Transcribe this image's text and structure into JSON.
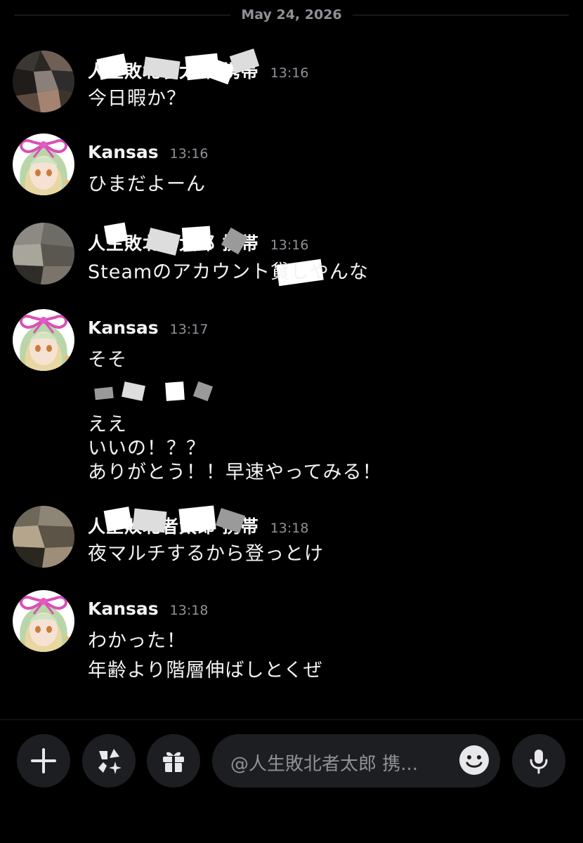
{
  "date_divider": "May 24, 2026",
  "messages": [
    {
      "author": "人生敗北者太郎 携帯",
      "time": "13:16",
      "lines": [
        "今日暇か？"
      ]
    },
    {
      "author": "Kansas",
      "time": "13:16",
      "lines": [
        "ひまだよーん"
      ]
    },
    {
      "author": "人生敗北者太郎 携帯",
      "time": "13:16",
      "lines": [
        "Steamのアカウント貸しやんな"
      ]
    },
    {
      "author": "Kansas",
      "time": "13:17",
      "lines": [
        "そそ"
      ]
    },
    {
      "author": "",
      "time": "",
      "lines": [
        "ええ",
        "いいの！？？",
        "ありがとう！！早速やってみる！"
      ]
    },
    {
      "author": "人生敗北者太郎 携帯",
      "time": "13:18",
      "lines": [
        "夜マルチするから登っとけ"
      ]
    },
    {
      "author": "Kansas",
      "time": "13:18",
      "lines": [
        "わかった！",
        "年齢より階層伸ばしとくぜ"
      ]
    }
  ],
  "composer": {
    "placeholder": "@人生敗北者太郎  携..."
  },
  "icons": {
    "add": "plus-icon",
    "apps": "apps-icon",
    "gift": "gift-icon",
    "emoji": "emoji-icon",
    "mic": "microphone-icon"
  },
  "colors": {
    "background": "#000000",
    "surface": "#1d1e22",
    "muted_text": "#8f9197",
    "ribbon_pink": "#d94fb8"
  }
}
